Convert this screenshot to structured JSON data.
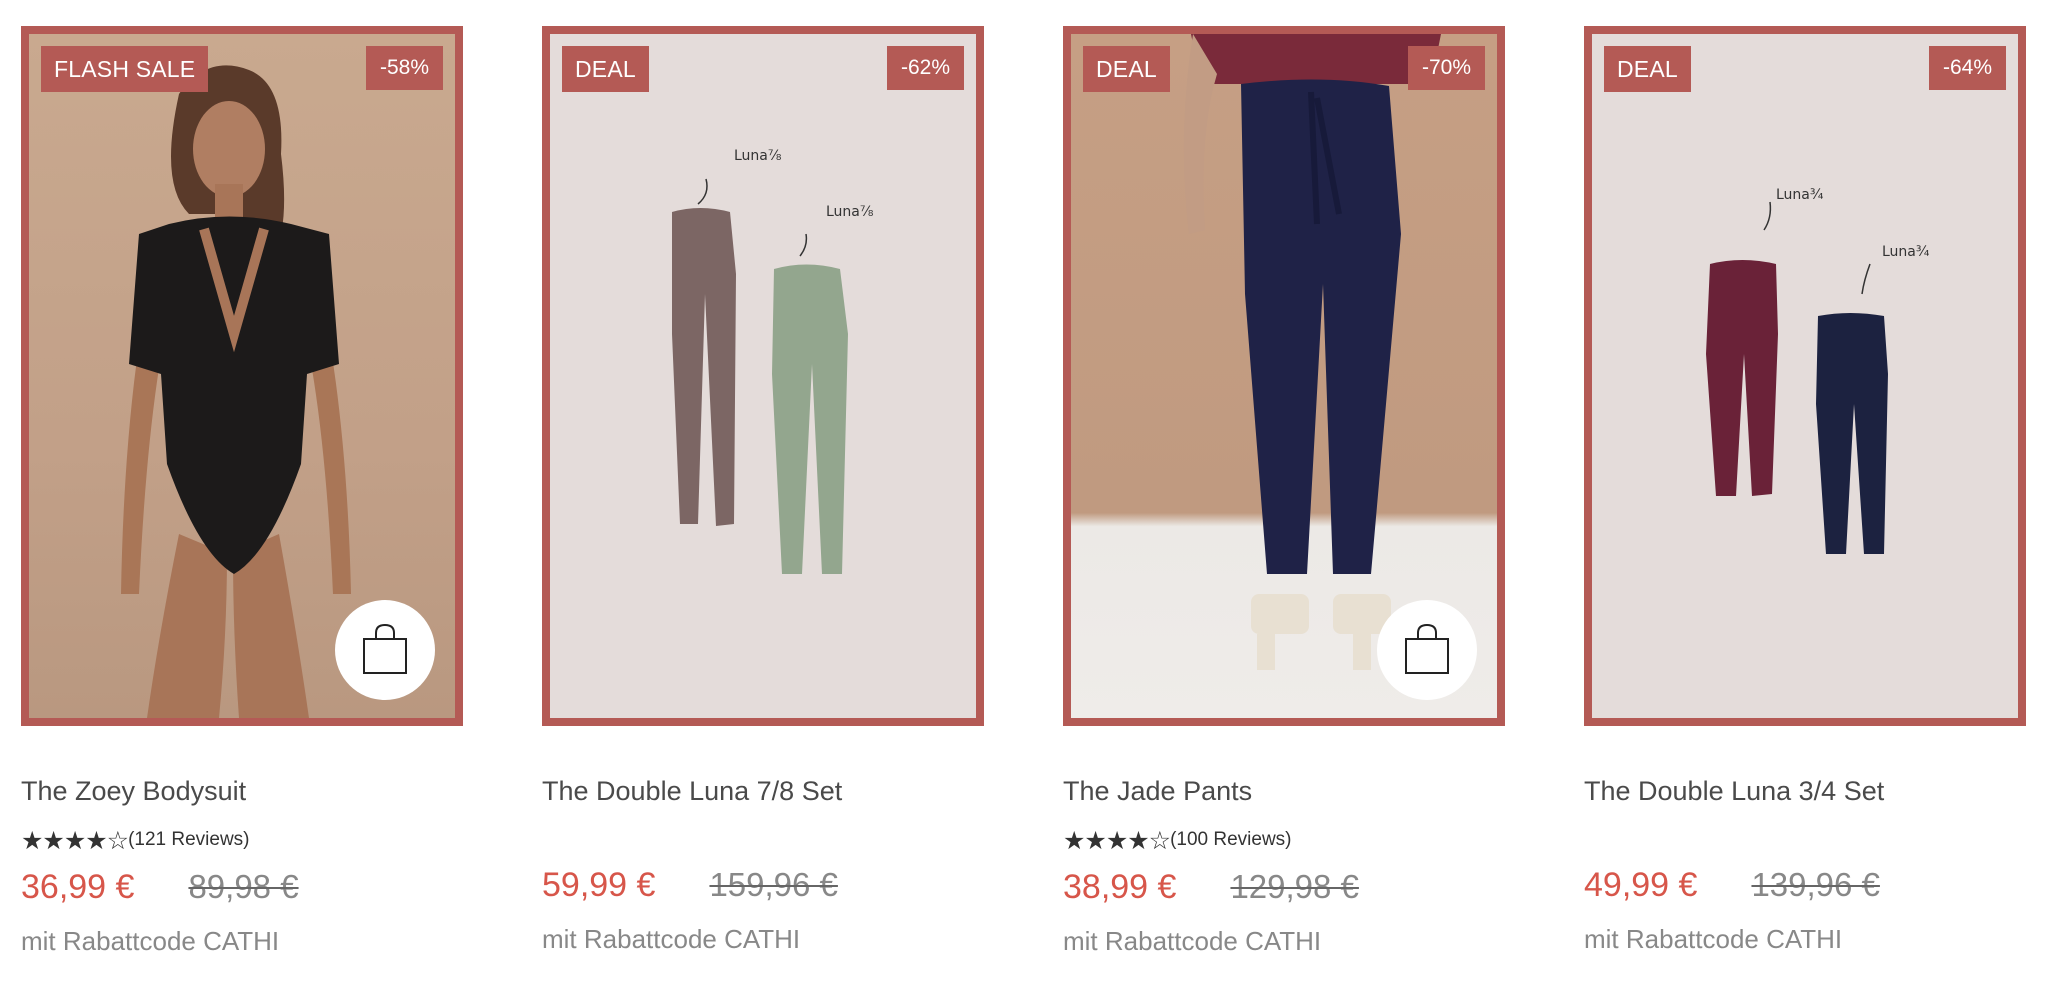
{
  "products": [
    {
      "badge": "FLASH SALE",
      "discount": "-58%",
      "title": "The Zoey Bodysuit",
      "stars": "★★★★☆",
      "reviews": "(121 Reviews)",
      "rating_value": 4.5,
      "price_now": "36,99 €",
      "price_old": "89,98 €",
      "code_text": "mit Rabattcode CATHI",
      "image_icon": "bodysuit-model-image"
    },
    {
      "badge": "DEAL",
      "discount": "-62%",
      "title": "The Double Luna 7/8 Set",
      "price_now": "59,99 €",
      "price_old": "159,96 €",
      "code_text": "mit Rabattcode CATHI",
      "label_a": "Luna⅞",
      "label_b": "Luna⅞",
      "image_icon": "leggings-set-image"
    },
    {
      "badge": "DEAL",
      "discount": "-70%",
      "title": "The Jade Pants",
      "stars": "★★★★☆",
      "reviews": "(100 Reviews)",
      "rating_value": 4.5,
      "price_now": "38,99 €",
      "price_old": "129,98 €",
      "code_text": "mit Rabattcode CATHI",
      "image_icon": "pants-model-image"
    },
    {
      "badge": "DEAL",
      "discount": "-64%",
      "title": "The Double Luna 3/4 Set",
      "price_now": "49,99 €",
      "price_old": "139,96 €",
      "code_text": "mit Rabattcode CATHI",
      "label_a": "Luna¾",
      "label_b": "Luna¾",
      "image_icon": "leggings-set-image"
    }
  ],
  "colors": {
    "accent": "#b45a55",
    "price": "#d7564a",
    "text": "#4a4a4a",
    "muted": "#888888"
  }
}
